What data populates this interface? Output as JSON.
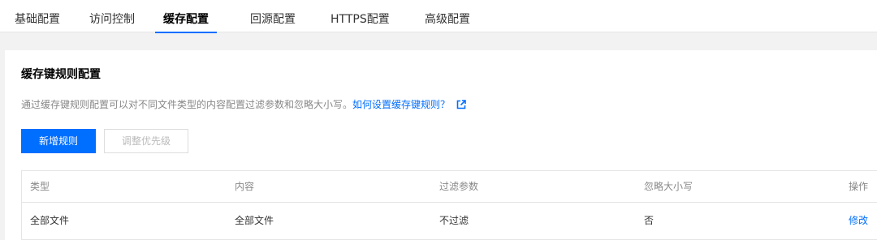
{
  "tabs": [
    {
      "label": "基础配置"
    },
    {
      "label": "访问控制"
    },
    {
      "label": "缓存配置"
    },
    {
      "label": "回源配置"
    },
    {
      "label": "HTTPS配置"
    },
    {
      "label": "高级配置"
    }
  ],
  "active_tab": "缓存配置",
  "section": {
    "title": "缓存键规则配置",
    "description": "通过缓存键规则配置可以对不同文件类型的内容配置过滤参数和忽略大小写。",
    "help_link": "如何设置缓存键规则？",
    "help_icon": "external-link-icon"
  },
  "buttons": {
    "add_rule": "新增规则",
    "adjust_priority": "调整优先级"
  },
  "table": {
    "headers": [
      "类型",
      "内容",
      "过滤参数",
      "忽略大小写",
      "操作"
    ],
    "rows": [
      {
        "type": "全部文件",
        "content": "全部文件",
        "filter": "不过滤",
        "ignore_case": "否",
        "action": "修改"
      }
    ]
  },
  "colors": {
    "accent": "#006eff",
    "background": "#f2f2f2"
  }
}
